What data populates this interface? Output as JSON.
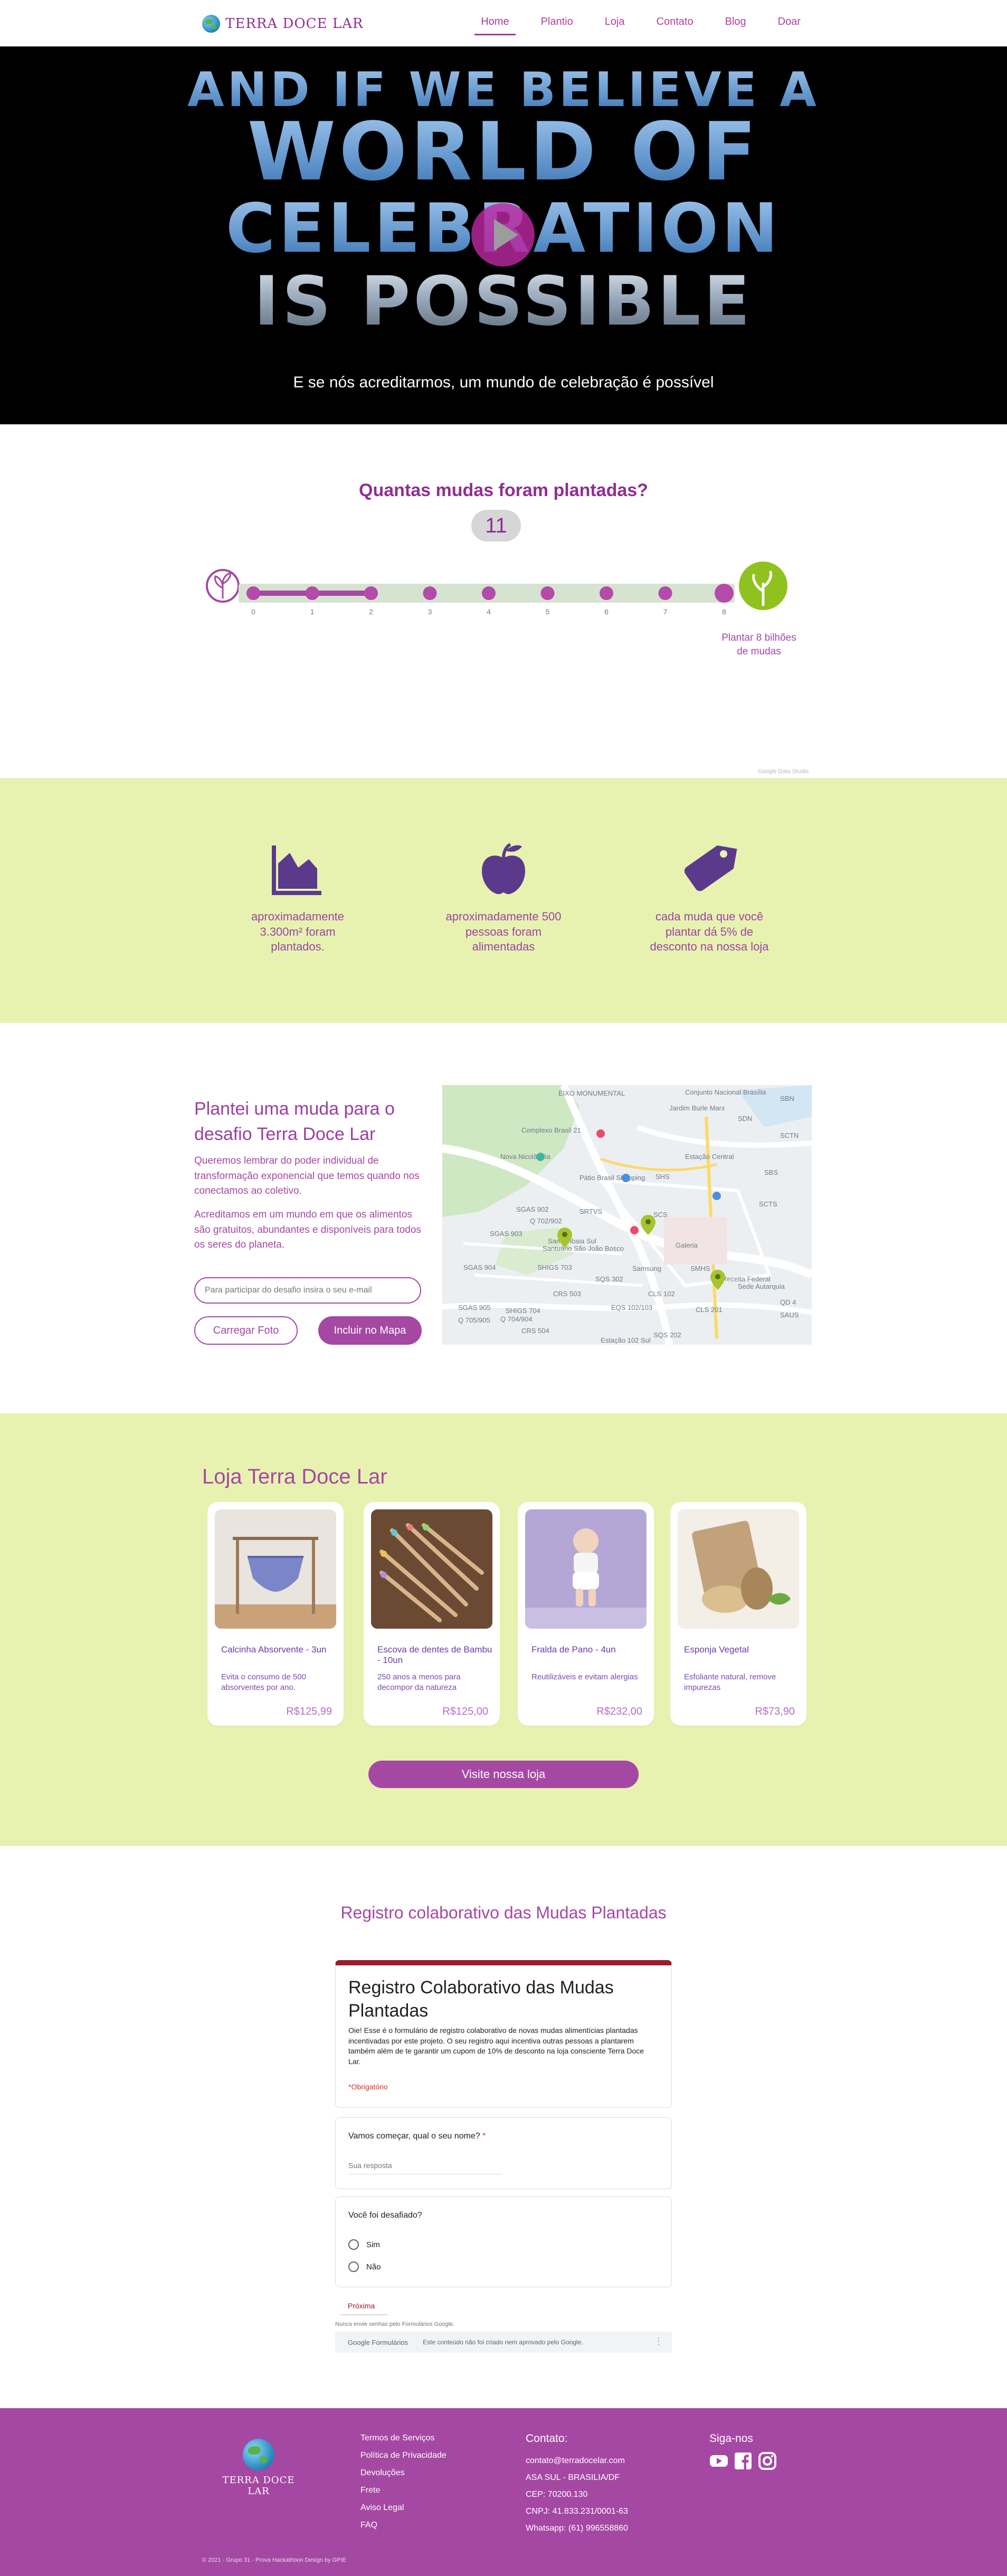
{
  "header": {
    "logo_text": "TERRA DOCE LAR",
    "nav": [
      {
        "label": "Home",
        "active": true
      },
      {
        "label": "Plantio",
        "active": false
      },
      {
        "label": "Loja",
        "active": false
      },
      {
        "label": "Contato",
        "active": false
      },
      {
        "label": "Blog",
        "active": false
      },
      {
        "label": "Doar",
        "active": false
      }
    ]
  },
  "hero": {
    "title_lines": [
      "AND IF WE BELIEVE A",
      "WORLD OF",
      "CELEBRATION",
      "IS POSSIBLE"
    ],
    "caption": "E se nós acreditarmos, um mundo de celebração é possível",
    "play_icon": "play-icon"
  },
  "counter": {
    "title": "Quantas mudas foram plantadas?",
    "count": "11",
    "ticks": [
      "0",
      "1",
      "2",
      "3",
      "4",
      "5",
      "6",
      "7",
      "8"
    ],
    "progress_fraction": 0.25,
    "goal_label_lines": [
      "Plantar 8 bilhões",
      "de mudas"
    ],
    "watermark": "Google Data Studio"
  },
  "stats": [
    {
      "icon": "chart-icon",
      "lines": [
        "aproximadamente",
        "3.300m² foram",
        "plantados."
      ]
    },
    {
      "icon": "apple-icon",
      "lines": [
        "aproximadamente 500",
        "pessoas foram",
        "alimentadas"
      ]
    },
    {
      "icon": "tag-icon",
      "lines": [
        "cada muda que você",
        "plantar dá 5% de",
        "desconto na nossa loja"
      ]
    }
  ],
  "plant": {
    "title": "Plantei uma muda para o desafio Terra Doce Lar",
    "p1": "Queremos lembrar do poder individual de transformação exponencial que temos quando nos conectamos ao coletivo.",
    "p2": "Acreditamos em um mundo em que os alimentos são gratuitos, abundantes e disponíveis para todos os seres do planeta.",
    "email_placeholder": "Para participar do desafio insira o seu e-mail",
    "upload_label": "Carregar Foto",
    "include_label": "Incluir no Mapa",
    "map_labels": [
      "EIXO MONUMENTAL",
      "Conjunto Nacional Brasília",
      "SBN",
      "Jardim Burle Marx",
      "SDN",
      "SCTN",
      "Complexo Brasil 21",
      "Nova Nicolândia",
      "Estação Central",
      "Pátio Brasil Shopping",
      "SHS",
      "SBS",
      "SGAS 902",
      "SRTVS",
      "SCS",
      "SCTS",
      "Q 702/902",
      "SGAS 903",
      "Samambaia Sul",
      "Santuário São João Bosco",
      "Galeria",
      "SGAS 904",
      "SHIGS 703",
      "Samsung",
      "SMHS",
      "Receita Federal",
      "SQS 302",
      "Sede Autarquia",
      "CRS 503",
      "CLS 102",
      "SGAS 905",
      "SHIGS 704",
      "EQS 102/103",
      "CLS 201",
      "QD 4",
      "Q 705/905",
      "CRS 504",
      "SQS 202",
      "SAUS",
      "Q 704/904",
      "Estação 102 Sul"
    ]
  },
  "store": {
    "title": "Loja Terra Doce Lar",
    "products": [
      {
        "name": "Calcinha Absorvente - 3un",
        "desc": "Evita o consumo de 500 absorventes por ano.",
        "price": "R$125,99"
      },
      {
        "name": "Escova de dentes de Bambu - 10un",
        "desc": "250 anos a menos para decompor da natureza",
        "price": "R$125,00"
      },
      {
        "name": "Fralda de Pano - 4un",
        "desc": "Reutilizáveis e evitam alergias",
        "price": "R$232,00"
      },
      {
        "name": "Esponja Vegetal",
        "desc": "Esfoliante natural, remove impurezas",
        "price": "R$73,90"
      }
    ],
    "button": "Visite nossa loja"
  },
  "form": {
    "section_title": "Registro colaborativo das Mudas Plantadas",
    "title": "Registro Colaborativo das Mudas Plantadas",
    "description": "Oie! Esse é o formulário de registro colaborativo de novas mudas alimentícias plantadas incentivadas por este projeto. O seu registro aqui incentiva outras pessoas a plantarem também além de te garantir um cupom de 10% de desconto na loja consciente Terra Doce Lar.",
    "required_note": "*Obrigatório",
    "q1": "Vamos começar, qual o seu nome?",
    "q1_required": "*",
    "q1_placeholder": "Sua resposta",
    "q2": "Você foi desafiado?",
    "options": [
      "Sim",
      "Não"
    ],
    "next": "Próxima",
    "never_submit": "Nunca envie senhas pelo Formulários Google.",
    "google_label": "Google Formulários",
    "google_note": "Este conteúdo não foi criado nem aprovado pelo Google.",
    "brand_color": "#9d1b2f"
  },
  "footer": {
    "logo_text": "TERRA DOCE LAR",
    "links": [
      "Termos de Serviços",
      "Política de Privacidade",
      "Devoluções",
      "Frete",
      "Aviso Legal",
      "FAQ"
    ],
    "contact_title": "Contato:",
    "contact": [
      "contato@terradocelar.com",
      "ASA SUL - BRASILIA/DF",
      "CEP: 70200.130",
      "CNPJ: 41.833.231/0001-63",
      "Whatsapp: (61) 996558860"
    ],
    "social_title": "Siga-nos",
    "social": [
      "youtube-icon",
      "facebook-icon",
      "instagram-icon"
    ],
    "copyright": "© 2021 - Grupo 31 - Prova Hackathoon Design by GPIE"
  },
  "colors": {
    "primary": "#a548a3",
    "green_bg": "#e8f2b0",
    "dark_purple": "#5b3a8c"
  }
}
